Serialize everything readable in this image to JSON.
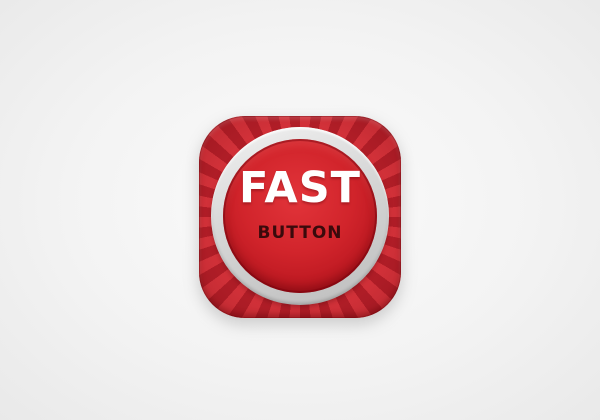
{
  "icon": {
    "title": "FAST",
    "subtitle": "BUTTON"
  },
  "colors": {
    "background": "#f3f3f3",
    "stripe_light": "#d9343c",
    "stripe_dark": "#b51f29",
    "ring": "#d6d6d6",
    "button_red": "#d1242b",
    "title_text": "#ffffff",
    "subtitle_text": "#3a0a0c"
  }
}
